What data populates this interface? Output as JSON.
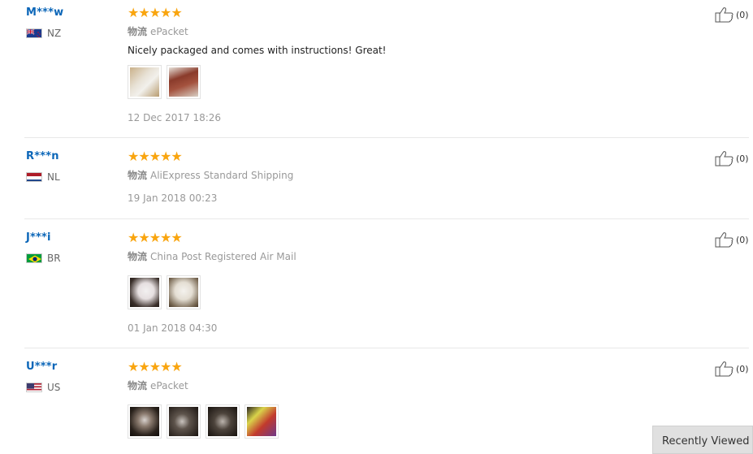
{
  "reviews": [
    {
      "user": "M***w",
      "country": "NZ",
      "stars": "★★★★★",
      "logistics_label": "物流",
      "logistics": "ePacket",
      "content": "Nicely packaged and comes with instructions! Great!",
      "date": "12 Dec 2017 18:26",
      "useful_count": "(0)"
    },
    {
      "user": "R***n",
      "country": "NL",
      "stars": "★★★★★",
      "logistics_label": "物流",
      "logistics": "AliExpress Standard Shipping",
      "date": "19 Jan 2018 00:23",
      "useful_count": "(0)"
    },
    {
      "user": "J***i",
      "country": "BR",
      "stars": "★★★★★",
      "logistics_label": "物流",
      "logistics": "China Post Registered Air Mail",
      "date": "01 Jan 2018 04:30",
      "useful_count": "(0)"
    },
    {
      "user": "U***r",
      "country": "US",
      "stars": "★★★★★",
      "logistics_label": "物流",
      "logistics": "ePacket",
      "useful_count": "(0)"
    }
  ],
  "recently_viewed": "Recently Viewed",
  "colors": {
    "username": "#0b66b8",
    "stars": "#f9a50f",
    "muted": "#999999"
  }
}
